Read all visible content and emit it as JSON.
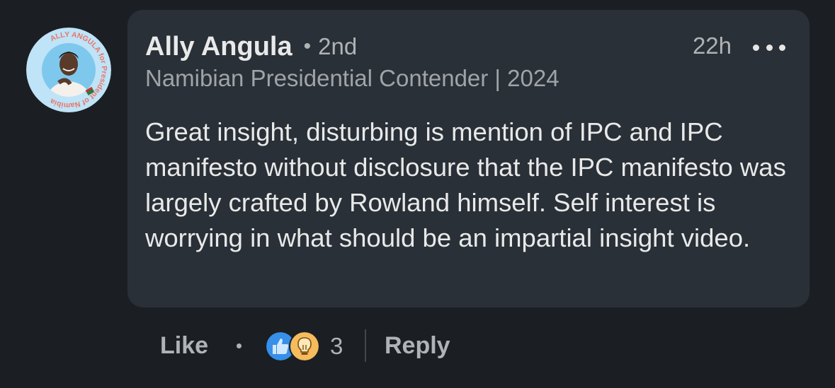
{
  "comment": {
    "author": {
      "name": "Ally Angula",
      "degree": "2nd",
      "headline": "Namibian Presidential Contender | 2024",
      "avatar_ring_text": "ALLY ANGULA for President of Namibia"
    },
    "timestamp": "22h",
    "more_icon": "more-horizontal-icon",
    "body": "Great insight, disturbing is mention of IPC and IPC manifesto without disclosure that the IPC manifesto was largely crafted by Rowland himself. Self interest is worrying in what should be an impartial insight video."
  },
  "actions": {
    "like_label": "Like",
    "reaction_icons": [
      "like-reaction-icon",
      "insightful-reaction-icon"
    ],
    "reaction_count": "3",
    "reply_label": "Reply"
  },
  "colors": {
    "page_background": "#1b1f23",
    "card_background": "#293037",
    "primary_text": "#e9e9e9",
    "secondary_text": "#b0b3b6",
    "like_blue": "#378fe9",
    "insightful_orange": "#f5bb5c",
    "avatar_ring_text": "#e8766a"
  }
}
